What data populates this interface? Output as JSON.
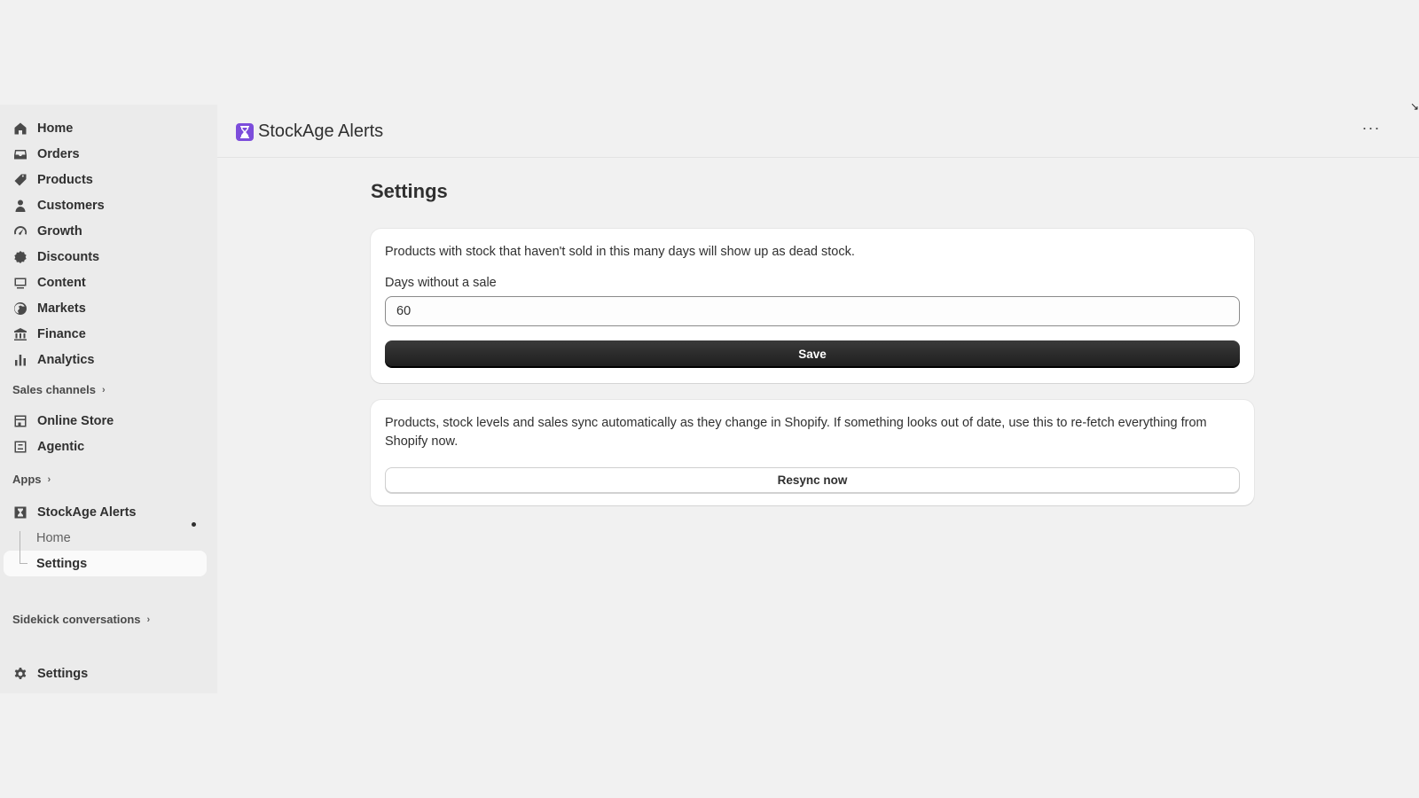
{
  "sidebar": {
    "nav": [
      {
        "label": "Home",
        "icon": "home-icon"
      },
      {
        "label": "Orders",
        "icon": "inbox-icon"
      },
      {
        "label": "Products",
        "icon": "tag-icon"
      },
      {
        "label": "Customers",
        "icon": "person-icon"
      },
      {
        "label": "Growth",
        "icon": "gauge-icon"
      },
      {
        "label": "Discounts",
        "icon": "discount-icon"
      },
      {
        "label": "Content",
        "icon": "content-icon"
      },
      {
        "label": "Markets",
        "icon": "globe-icon"
      },
      {
        "label": "Finance",
        "icon": "bank-icon"
      },
      {
        "label": "Analytics",
        "icon": "bar-chart-icon"
      }
    ],
    "sales_channels_heading": "Sales channels",
    "sales_channels": [
      {
        "label": "Online Store",
        "icon": "store-icon"
      },
      {
        "label": "Agentic",
        "icon": "agentic-icon"
      }
    ],
    "apps_heading": "Apps",
    "app": {
      "label": "StockAge Alerts",
      "icon": "hourglass-icon"
    },
    "app_sub_items": [
      {
        "label": "Home"
      },
      {
        "label": "Settings",
        "active": true
      }
    ],
    "sidekick_heading": "Sidekick conversations",
    "settings": {
      "label": "Settings",
      "icon": "gear-icon"
    }
  },
  "header": {
    "app_title": "StockAge Alerts",
    "logo_color": "#7c4ddb",
    "more_label": "···"
  },
  "main": {
    "page_title": "Settings",
    "dead_stock_card": {
      "description": "Products with stock that haven't sold in this many days will show up as dead stock.",
      "field_label": "Days without a sale",
      "field_value": "60",
      "save_label": "Save"
    },
    "resync_card": {
      "description": "Products, stock levels and sales sync automatically as they change in Shopify. If something looks out of date, use this to re-fetch everything from Shopify now.",
      "button_label": "Resync now"
    }
  }
}
